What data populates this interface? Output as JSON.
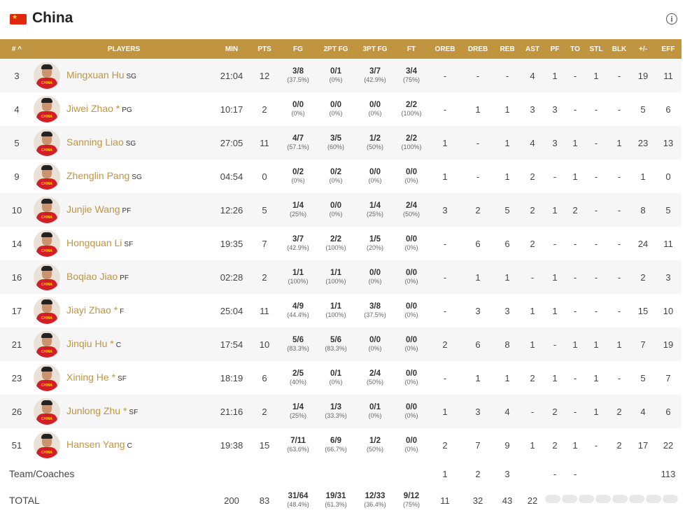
{
  "team": {
    "name": "China"
  },
  "columns": [
    "# ^",
    "PLAYERS",
    "MIN",
    "PTS",
    "FG",
    "2PT FG",
    "3PT FG",
    "FT",
    "OREB",
    "DREB",
    "REB",
    "AST",
    "PF",
    "TO",
    "STL",
    "BLK",
    "+/-",
    "EFF"
  ],
  "players": [
    {
      "no": "3",
      "name": "Mingxuan Hu",
      "pos": "SG",
      "min": "21:04",
      "pts": "12",
      "fg": "3/8",
      "fgp": "(37.5%)",
      "fg2": "0/1",
      "fg2p": "(0%)",
      "fg3": "3/7",
      "fg3p": "(42.9%)",
      "ft": "3/4",
      "ftp": "(75%)",
      "oreb": "-",
      "dreb": "-",
      "reb": "-",
      "ast": "4",
      "pf": "1",
      "to": "-",
      "stl": "1",
      "blk": "-",
      "pm": "19",
      "eff": "11"
    },
    {
      "no": "4",
      "name": "Jiwei Zhao *",
      "pos": "PG",
      "min": "10:17",
      "pts": "2",
      "fg": "0/0",
      "fgp": "(0%)",
      "fg2": "0/0",
      "fg2p": "(0%)",
      "fg3": "0/0",
      "fg3p": "(0%)",
      "ft": "2/2",
      "ftp": "(100%)",
      "oreb": "-",
      "dreb": "1",
      "reb": "1",
      "ast": "3",
      "pf": "3",
      "to": "-",
      "stl": "-",
      "blk": "-",
      "pm": "5",
      "eff": "6"
    },
    {
      "no": "5",
      "name": "Sanning Liao",
      "pos": "SG",
      "min": "27:05",
      "pts": "11",
      "fg": "4/7",
      "fgp": "(57.1%)",
      "fg2": "3/5",
      "fg2p": "(60%)",
      "fg3": "1/2",
      "fg3p": "(50%)",
      "ft": "2/2",
      "ftp": "(100%)",
      "oreb": "1",
      "dreb": "-",
      "reb": "1",
      "ast": "4",
      "pf": "3",
      "to": "1",
      "stl": "-",
      "blk": "1",
      "pm": "23",
      "eff": "13"
    },
    {
      "no": "9",
      "name": "Zhenglin Pang",
      "pos": "SG",
      "min": "04:54",
      "pts": "0",
      "fg": "0/2",
      "fgp": "(0%)",
      "fg2": "0/2",
      "fg2p": "(0%)",
      "fg3": "0/0",
      "fg3p": "(0%)",
      "ft": "0/0",
      "ftp": "(0%)",
      "oreb": "1",
      "dreb": "-",
      "reb": "1",
      "ast": "2",
      "pf": "-",
      "to": "1",
      "stl": "-",
      "blk": "-",
      "pm": "1",
      "eff": "0"
    },
    {
      "no": "10",
      "name": "Junjie Wang",
      "pos": "PF",
      "min": "12:26",
      "pts": "5",
      "fg": "1/4",
      "fgp": "(25%)",
      "fg2": "0/0",
      "fg2p": "(0%)",
      "fg3": "1/4",
      "fg3p": "(25%)",
      "ft": "2/4",
      "ftp": "(50%)",
      "oreb": "3",
      "dreb": "2",
      "reb": "5",
      "ast": "2",
      "pf": "1",
      "to": "2",
      "stl": "-",
      "blk": "-",
      "pm": "8",
      "eff": "5"
    },
    {
      "no": "14",
      "name": "Hongquan Li",
      "pos": "SF",
      "min": "19:35",
      "pts": "7",
      "fg": "3/7",
      "fgp": "(42.9%)",
      "fg2": "2/2",
      "fg2p": "(100%)",
      "fg3": "1/5",
      "fg3p": "(20%)",
      "ft": "0/0",
      "ftp": "(0%)",
      "oreb": "-",
      "dreb": "6",
      "reb": "6",
      "ast": "2",
      "pf": "-",
      "to": "-",
      "stl": "-",
      "blk": "-",
      "pm": "24",
      "eff": "11"
    },
    {
      "no": "16",
      "name": "Boqiao Jiao",
      "pos": "PF",
      "min": "02:28",
      "pts": "2",
      "fg": "1/1",
      "fgp": "(100%)",
      "fg2": "1/1",
      "fg2p": "(100%)",
      "fg3": "0/0",
      "fg3p": "(0%)",
      "ft": "0/0",
      "ftp": "(0%)",
      "oreb": "-",
      "dreb": "1",
      "reb": "1",
      "ast": "-",
      "pf": "1",
      "to": "-",
      "stl": "-",
      "blk": "-",
      "pm": "2",
      "eff": "3"
    },
    {
      "no": "17",
      "name": "Jiayi Zhao *",
      "pos": "F",
      "min": "25:04",
      "pts": "11",
      "fg": "4/9",
      "fgp": "(44.4%)",
      "fg2": "1/1",
      "fg2p": "(100%)",
      "fg3": "3/8",
      "fg3p": "(37.5%)",
      "ft": "0/0",
      "ftp": "(0%)",
      "oreb": "-",
      "dreb": "3",
      "reb": "3",
      "ast": "1",
      "pf": "1",
      "to": "-",
      "stl": "-",
      "blk": "-",
      "pm": "15",
      "eff": "10"
    },
    {
      "no": "21",
      "name": "Jinqiu Hu *",
      "pos": "C",
      "min": "17:54",
      "pts": "10",
      "fg": "5/6",
      "fgp": "(83.3%)",
      "fg2": "5/6",
      "fg2p": "(83.3%)",
      "fg3": "0/0",
      "fg3p": "(0%)",
      "ft": "0/0",
      "ftp": "(0%)",
      "oreb": "2",
      "dreb": "6",
      "reb": "8",
      "ast": "1",
      "pf": "-",
      "to": "1",
      "stl": "1",
      "blk": "1",
      "pm": "7",
      "eff": "19"
    },
    {
      "no": "23",
      "name": "Xining He *",
      "pos": "SF",
      "min": "18:19",
      "pts": "6",
      "fg": "2/5",
      "fgp": "(40%)",
      "fg2": "0/1",
      "fg2p": "(0%)",
      "fg3": "2/4",
      "fg3p": "(50%)",
      "ft": "0/0",
      "ftp": "(0%)",
      "oreb": "-",
      "dreb": "1",
      "reb": "1",
      "ast": "2",
      "pf": "1",
      "to": "-",
      "stl": "1",
      "blk": "-",
      "pm": "5",
      "eff": "7"
    },
    {
      "no": "26",
      "name": "Junlong Zhu *",
      "pos": "SF",
      "min": "21:16",
      "pts": "2",
      "fg": "1/4",
      "fgp": "(25%)",
      "fg2": "1/3",
      "fg2p": "(33.3%)",
      "fg3": "0/1",
      "fg3p": "(0%)",
      "ft": "0/0",
      "ftp": "(0%)",
      "oreb": "1",
      "dreb": "3",
      "reb": "4",
      "ast": "-",
      "pf": "2",
      "to": "-",
      "stl": "1",
      "blk": "2",
      "pm": "4",
      "eff": "6"
    },
    {
      "no": "51",
      "name": "Hansen Yang",
      "pos": "C",
      "min": "19:38",
      "pts": "15",
      "fg": "7/11",
      "fgp": "(63.6%)",
      "fg2": "6/9",
      "fg2p": "(66.7%)",
      "fg3": "1/2",
      "fg3p": "(50%)",
      "ft": "0/0",
      "ftp": "(0%)",
      "oreb": "2",
      "dreb": "7",
      "reb": "9",
      "ast": "1",
      "pf": "2",
      "to": "1",
      "stl": "-",
      "blk": "2",
      "pm": "17",
      "eff": "22"
    }
  ],
  "team_row": {
    "label": "Team/Coaches",
    "oreb": "1",
    "dreb": "2",
    "reb": "3",
    "pf": "-",
    "to": "-",
    "eff": "113"
  },
  "total_row": {
    "label": "TOTAL",
    "min": "200",
    "pts": "83",
    "fg": "31/64",
    "fgp": "(48.4%)",
    "fg2": "19/31",
    "fg2p": "(61.3%)",
    "fg3": "12/33",
    "fg3p": "(36.4%)",
    "ft": "9/12",
    "ftp": "(75%)",
    "oreb": "11",
    "dreb": "32",
    "reb": "43",
    "ast": "22"
  },
  "avatar_text": "CHINA",
  "colors": {
    "header_bg": "#c1953f",
    "accent": "#c1953f",
    "flag": "#de2910"
  }
}
